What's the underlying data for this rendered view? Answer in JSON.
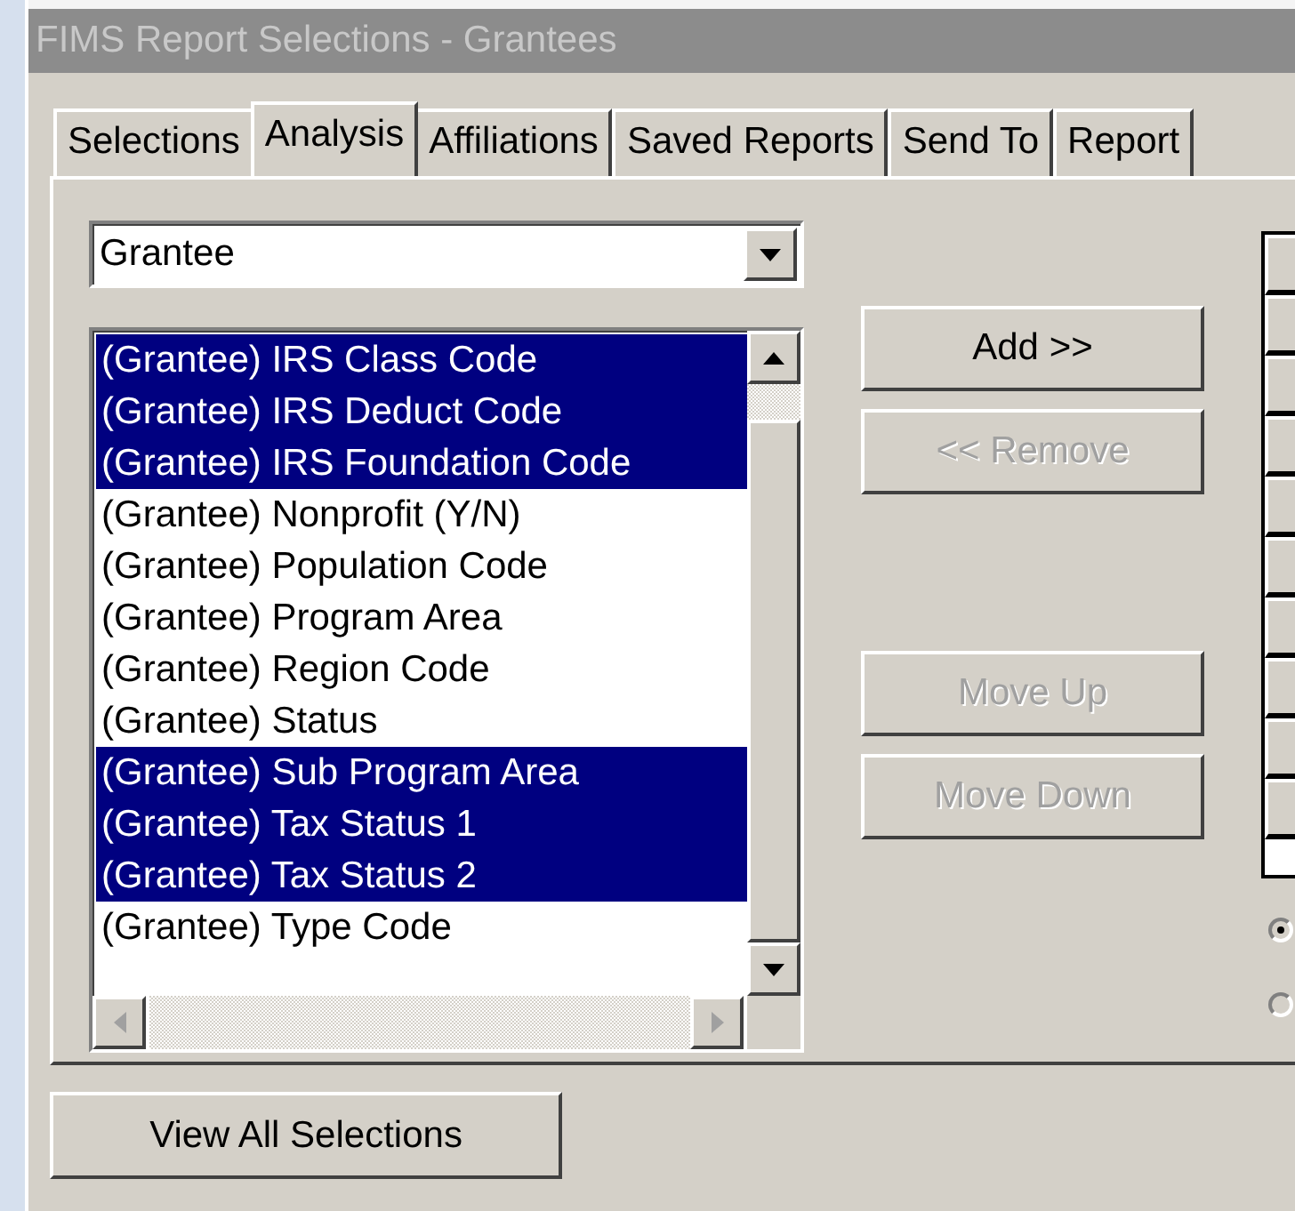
{
  "window": {
    "title": "FIMS Report Selections - Grantees"
  },
  "tabs": [
    {
      "label": "Selections",
      "selected": false
    },
    {
      "label": "Analysis",
      "selected": true
    },
    {
      "label": "Affiliations",
      "selected": false
    },
    {
      "label": "Saved Reports",
      "selected": false
    },
    {
      "label": "Send To",
      "selected": false
    },
    {
      "label": "Report",
      "selected": false
    }
  ],
  "dropdown": {
    "value": "Grantee"
  },
  "fields_list": {
    "items": [
      {
        "label": "(Grantee) IRS Class Code",
        "selected": true
      },
      {
        "label": "(Grantee) IRS Deduct Code",
        "selected": true
      },
      {
        "label": "(Grantee) IRS Foundation Code",
        "selected": true
      },
      {
        "label": "(Grantee) Nonprofit (Y/N)",
        "selected": false
      },
      {
        "label": "(Grantee) Population Code",
        "selected": false
      },
      {
        "label": "(Grantee) Program Area",
        "selected": false
      },
      {
        "label": "(Grantee) Region Code",
        "selected": false
      },
      {
        "label": "(Grantee) Status",
        "selected": false
      },
      {
        "label": "(Grantee) Sub Program Area",
        "selected": true
      },
      {
        "label": "(Grantee) Tax Status 1",
        "selected": true
      },
      {
        "label": "(Grantee) Tax Status 2",
        "selected": true
      },
      {
        "label": "(Grantee) Type Code",
        "selected": false
      }
    ]
  },
  "buttons": [
    {
      "label": "Add >>",
      "disabled": false
    },
    {
      "label": "<< Remove",
      "disabled": true
    },
    {
      "label": "Move Up",
      "disabled": true
    },
    {
      "label": "Move Down",
      "disabled": true
    }
  ],
  "radio_options": [
    {
      "selected": true
    },
    {
      "selected": false
    }
  ],
  "view_all_button": {
    "label": "View All Selections"
  }
}
